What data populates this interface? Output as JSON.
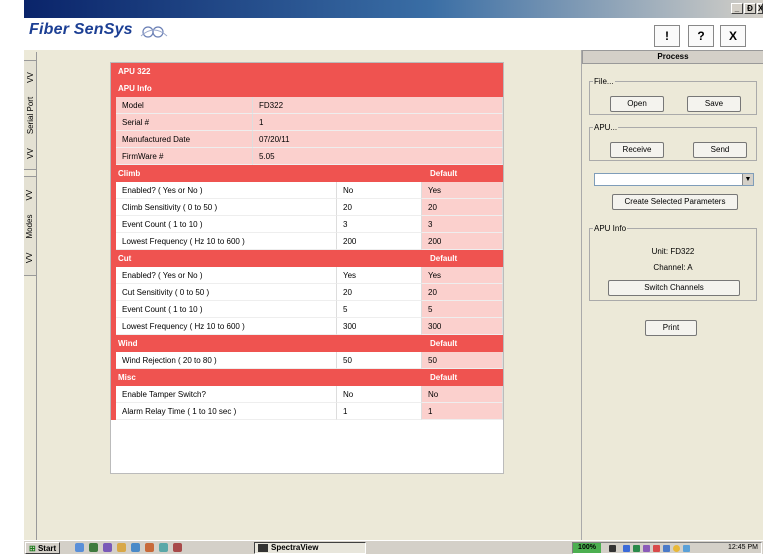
{
  "titlebar": {
    "min_label": "_",
    "max_label": "Ɖ",
    "close_label": "X"
  },
  "header": {
    "logo": "Fiber SenSys",
    "help_buttons": [
      "!",
      "?",
      "X"
    ]
  },
  "sidebar": {
    "serial_tab": {
      "label": "Serial Port",
      "arrows": "VV"
    },
    "modes_tab": {
      "label": "Modes",
      "arrows": "VV"
    }
  },
  "grid": {
    "unit_title": "APU 322",
    "info_title": "APU Info",
    "info_rows": [
      {
        "label": "Model",
        "value": "FD322"
      },
      {
        "label": "Serial #",
        "value": "1"
      },
      {
        "label": "Manufactured Date",
        "value": "07/20/11"
      },
      {
        "label": "FirmWare #",
        "value": "5.05"
      }
    ],
    "sections": [
      {
        "title": "Climb",
        "default_label": "Default",
        "rows": [
          {
            "label": "Enabled? ( Yes or No )",
            "value": "No",
            "default": "Yes"
          },
          {
            "label": "Climb Sensitivity ( 0 to 50 )",
            "value": "20",
            "default": "20"
          },
          {
            "label": "Event Count ( 1 to 10 )",
            "value": "3",
            "default": "3"
          },
          {
            "label": "Lowest Frequency ( Hz 10 to 600 )",
            "value": "200",
            "default": "200"
          }
        ]
      },
      {
        "title": "Cut",
        "default_label": "Default",
        "rows": [
          {
            "label": "Enabled? ( Yes or No )",
            "value": "Yes",
            "default": "Yes"
          },
          {
            "label": "Cut Sensitivity ( 0 to 50 )",
            "value": "20",
            "default": "20"
          },
          {
            "label": "Event Count ( 1 to 10 )",
            "value": "5",
            "default": "5"
          },
          {
            "label": "Lowest Frequency ( Hz 10 to 600 )",
            "value": "300",
            "default": "300"
          }
        ]
      },
      {
        "title": "Wind",
        "default_label": "Default",
        "rows": [
          {
            "label": "Wind Rejection ( 20 to 80 )",
            "value": "50",
            "default": "50"
          }
        ]
      },
      {
        "title": "Misc",
        "default_label": "Default",
        "rows": [
          {
            "label": "Enable Tamper Switch?",
            "value": "No",
            "default": "No"
          },
          {
            "label": "Alarm Relay Time ( 1 to 10 sec )",
            "value": "1",
            "default": "1"
          }
        ]
      }
    ]
  },
  "process": {
    "header": "Process",
    "file_group": {
      "legend": "File...",
      "open_label": "Open",
      "save_label": "Save"
    },
    "apu_group": {
      "legend": "APU...",
      "receive_label": "Receive",
      "send_label": "Send"
    },
    "combo_value": "",
    "create_params_label": "Create Selected Parameters",
    "apu_info_group": {
      "legend": "APU Info",
      "unit_text": "Unit: FD322",
      "channel_text": "Channel: A",
      "switch_label": "Switch Channels"
    },
    "print_label": "Print"
  },
  "taskbar": {
    "start_label": "Start",
    "task_label": "SpectraView",
    "zoom_label": "100%",
    "clock": "12:45 PM"
  },
  "colors": {
    "section_red": "#ef5350",
    "row_pink": "#fbd0cd",
    "brand_blue": "#1c3f94"
  }
}
